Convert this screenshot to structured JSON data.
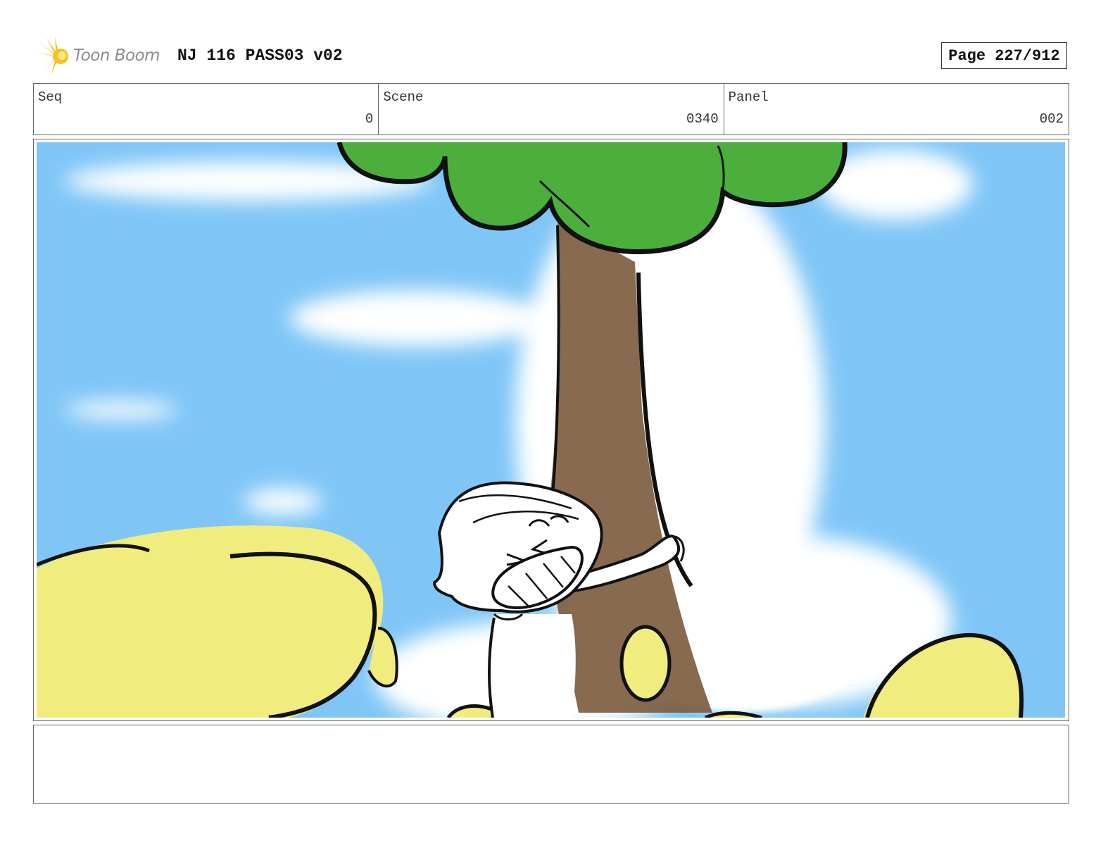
{
  "header": {
    "logo_text": "Toon Boom",
    "project_title": "NJ 116 PASS03 v02",
    "page_label": "Page 227/912"
  },
  "info": {
    "seq_label": "Seq",
    "seq_value": "0",
    "scene_label": "Scene",
    "scene_value": "0340",
    "panel_label": "Panel",
    "panel_value": "002"
  },
  "panel": {
    "colors": {
      "sky": "#7fc6f7",
      "foliage": "#4caf3c",
      "trunk": "#7a5a3c",
      "bush": "#f0ec7e",
      "ink": "#111111"
    }
  },
  "notes": {
    "text": ""
  }
}
